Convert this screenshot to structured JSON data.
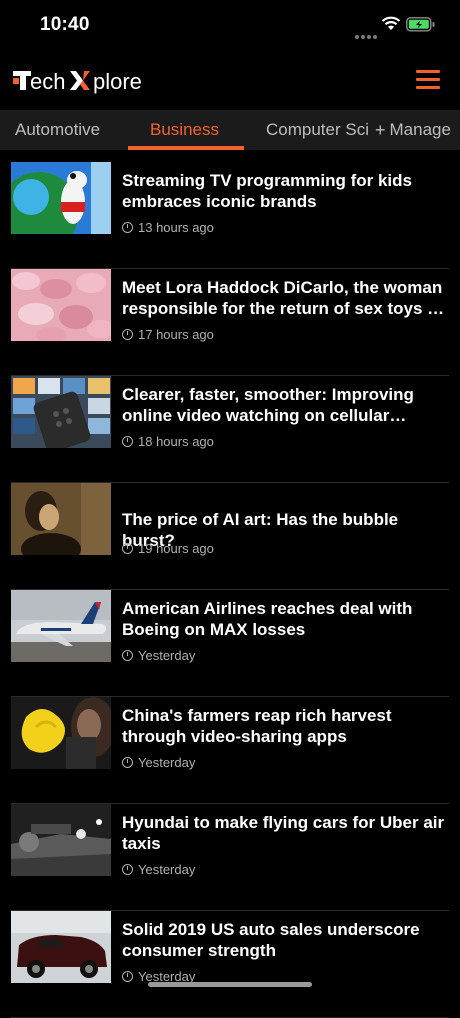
{
  "status": {
    "time": "10:40"
  },
  "header": {
    "logo_text_1": "ech",
    "logo_text_2": "plore",
    "accent": "#f2622e"
  },
  "tabs": [
    {
      "label": "Automotive",
      "active": false
    },
    {
      "label": "Business",
      "active": true
    },
    {
      "label": "Computer Sci",
      "active": false
    }
  ],
  "manage_label": "Manage",
  "articles": [
    {
      "title": "Streaming TV programming for kids embraces iconic brands",
      "time": "13 hours ago"
    },
    {
      "title": "Meet Lora Haddock DiCarlo, the woman responsible for the return of sex toys at CES",
      "time": "17 hours ago"
    },
    {
      "title": "Clearer, faster, smoother: Improving online video watching on cellular networks",
      "time": "18 hours ago"
    },
    {
      "title": "The price of AI art: Has the bubble burst?",
      "time": "19 hours ago"
    },
    {
      "title": "American Airlines reaches deal with Boeing on MAX losses",
      "time": "Yesterday"
    },
    {
      "title": "China's farmers reap rich harvest through video-sharing apps",
      "time": "Yesterday"
    },
    {
      "title": "Hyundai to make flying cars for Uber air taxis",
      "time": "Yesterday"
    },
    {
      "title": "Solid 2019 US auto sales underscore consumer strength",
      "time": "Yesterday"
    }
  ]
}
